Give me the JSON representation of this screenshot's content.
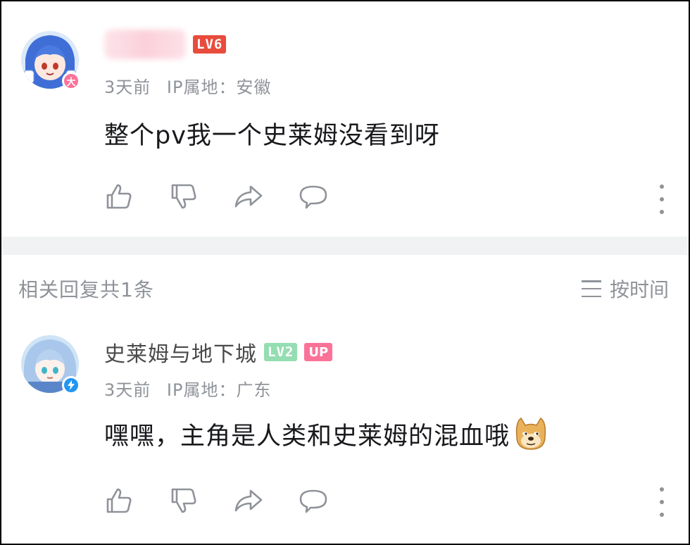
{
  "comment": {
    "level": "LV6",
    "avatar_badge": "大",
    "time": "3天前",
    "ip": "IP属地：安徽",
    "text": "整个pv我一个史莱姆没看到呀"
  },
  "reply_header": {
    "count_label": "相关回复共1条",
    "sort_label": "按时间"
  },
  "reply": {
    "username": "史莱姆与地下城",
    "level": "LV2",
    "up_tag": "UP",
    "time": "3天前",
    "ip": "IP属地：广东",
    "text": "嘿嘿，主角是人类和史莱姆的混血哦",
    "emoji": "doge-emoji"
  },
  "icons": [
    "like-icon",
    "dislike-icon",
    "share-icon",
    "reply-icon",
    "more-icon"
  ],
  "colors": {
    "lv6": "#e84c3d",
    "lv2": "#95ddb2",
    "up_tag": "#fb7299",
    "meta_text": "#8f9399"
  }
}
